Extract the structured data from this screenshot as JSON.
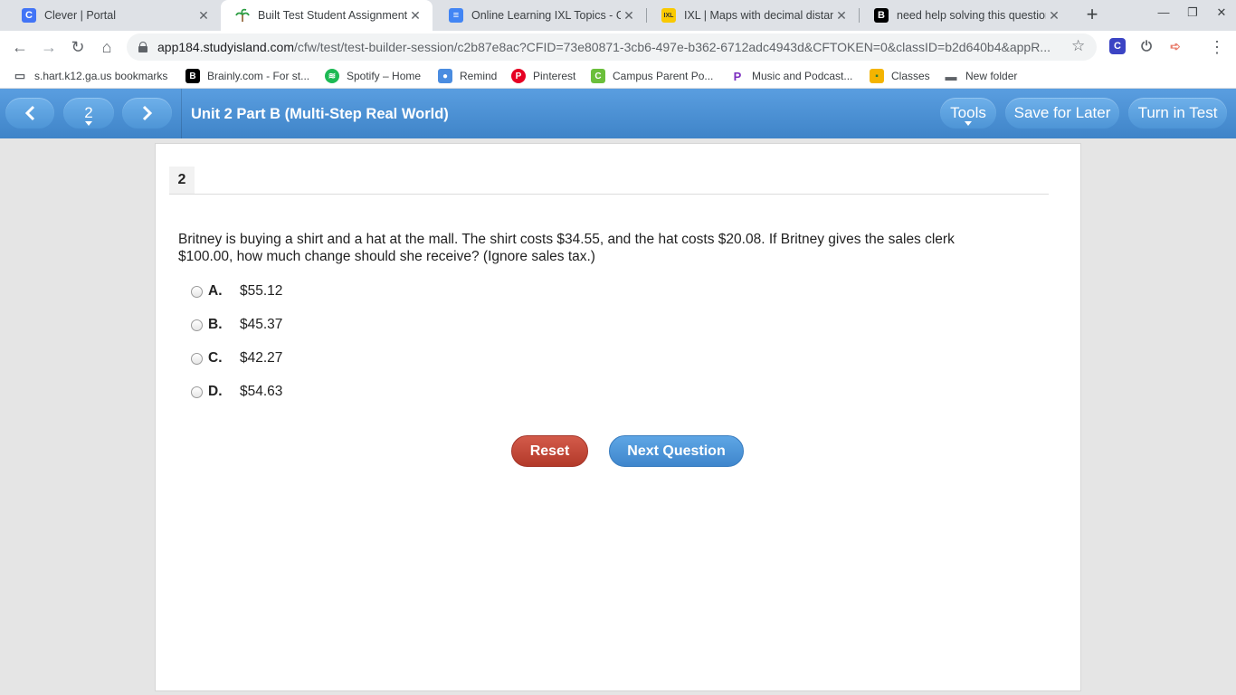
{
  "browser": {
    "tabs": [
      {
        "title": "Clever | Portal",
        "icon": "clever-icon",
        "color": "#4274f6"
      },
      {
        "title": "Built Test Student Assignment - ",
        "icon": "studyisland-icon",
        "color": "#4caf50"
      },
      {
        "title": "Online Learning IXL Topics - Goo",
        "icon": "google-docs-icon",
        "color": "#4285f4"
      },
      {
        "title": "IXL | Maps with decimal distanc",
        "icon": "ixl-icon",
        "color": "#f9c900"
      },
      {
        "title": "need help solving this question!",
        "icon": "brainly-icon",
        "color": "#000000"
      }
    ],
    "url_host": "app184.studyisland.com",
    "url_path": "/cfw/test/test-builder-session/c2b87e8ac?CFID=73e80871-3cb6-497e-b362-6712adc4943d&CFTOKEN=0&classID=b2d640b4&appR...",
    "bookmarks": [
      {
        "label": "s.hart.k12.ga.us bookmarks",
        "icon": "folder-icon"
      },
      {
        "label": "Brainly.com - For st...",
        "icon": "brainly-icon"
      },
      {
        "label": "Spotify – Home",
        "icon": "spotify-icon"
      },
      {
        "label": "Remind",
        "icon": "remind-icon"
      },
      {
        "label": "Pinterest",
        "icon": "pinterest-icon"
      },
      {
        "label": "Campus Parent Po...",
        "icon": "campus-icon"
      },
      {
        "label": "Music and Podcast...",
        "icon": "pandora-icon"
      },
      {
        "label": "Classes",
        "icon": "classroom-icon"
      },
      {
        "label": "New folder",
        "icon": "folder-icon"
      }
    ]
  },
  "header": {
    "page_selector": "2",
    "title": "Unit 2 Part B (Multi-Step Real World)",
    "tools_label": "Tools",
    "save_label": "Save for Later",
    "turnin_label": "Turn in Test"
  },
  "question": {
    "number": "2",
    "text": "Britney is buying a shirt and a hat at the mall. The shirt costs $34.55, and the hat costs $20.08. If Britney gives the sales clerk $100.00, how much change should she receive? (Ignore sales tax.)",
    "choices": [
      {
        "letter": "A.",
        "value": "$55.12"
      },
      {
        "letter": "B.",
        "value": "$45.37"
      },
      {
        "letter": "C.",
        "value": "$42.27"
      },
      {
        "letter": "D.",
        "value": "$54.63"
      }
    ]
  },
  "actions": {
    "reset_label": "Reset",
    "next_label": "Next Question"
  }
}
